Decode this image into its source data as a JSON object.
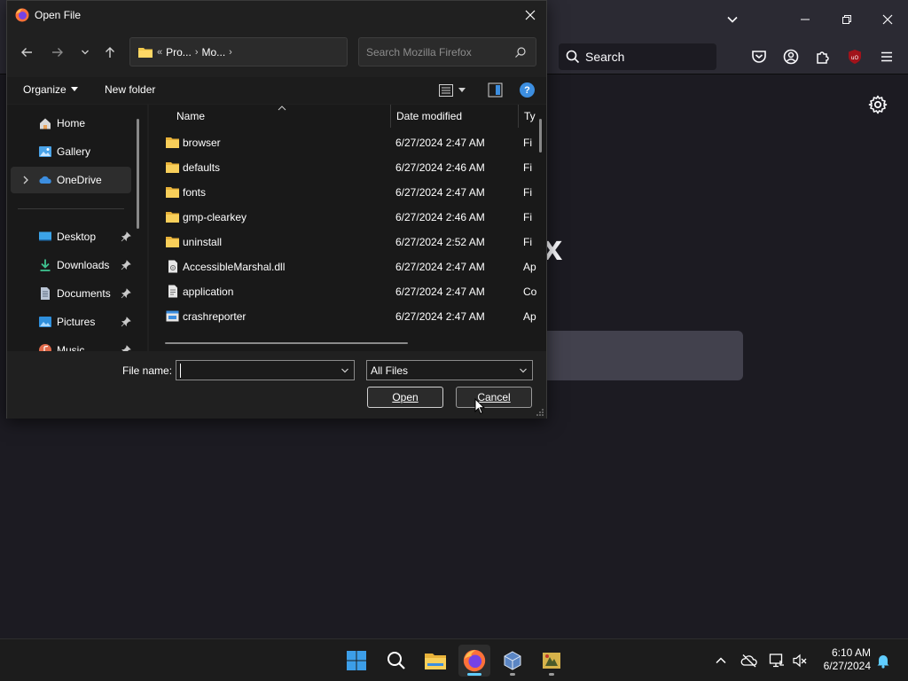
{
  "firefox": {
    "search_label": "Search",
    "logo_fragment": "x"
  },
  "dialog": {
    "title": "Open File",
    "address": {
      "overflow": "«",
      "crumb1": "Pro...",
      "crumb2": "Mo..."
    },
    "search_placeholder": "Search Mozilla Firefox",
    "organize_label": "Organize",
    "new_folder_label": "New folder",
    "nav_items": [
      {
        "label": "Home",
        "icon": "home-icon"
      },
      {
        "label": "Gallery",
        "icon": "gallery-icon"
      },
      {
        "label": "OneDrive",
        "icon": "onedrive-icon",
        "selected": true
      },
      {
        "label": "Desktop",
        "icon": "desktop-icon",
        "pinned": true
      },
      {
        "label": "Downloads",
        "icon": "downloads-icon",
        "pinned": true
      },
      {
        "label": "Documents",
        "icon": "documents-icon",
        "pinned": true
      },
      {
        "label": "Pictures",
        "icon": "pictures-icon",
        "pinned": true
      },
      {
        "label": "Music",
        "icon": "music-icon",
        "pinned": true
      }
    ],
    "columns": {
      "name": "Name",
      "date": "Date modified",
      "type": "Ty"
    },
    "files": [
      {
        "name": "browser",
        "date": "6/27/2024 2:47 AM",
        "type": "Fi",
        "kind": "folder"
      },
      {
        "name": "defaults",
        "date": "6/27/2024 2:46 AM",
        "type": "Fi",
        "kind": "folder"
      },
      {
        "name": "fonts",
        "date": "6/27/2024 2:47 AM",
        "type": "Fi",
        "kind": "folder"
      },
      {
        "name": "gmp-clearkey",
        "date": "6/27/2024 2:46 AM",
        "type": "Fi",
        "kind": "folder"
      },
      {
        "name": "uninstall",
        "date": "6/27/2024 2:52 AM",
        "type": "Fi",
        "kind": "folder"
      },
      {
        "name": "AccessibleMarshal.dll",
        "date": "6/27/2024 2:47 AM",
        "type": "Ap",
        "kind": "dll"
      },
      {
        "name": "application",
        "date": "6/27/2024 2:47 AM",
        "type": "Co",
        "kind": "config"
      },
      {
        "name": "crashreporter",
        "date": "6/27/2024 2:47 AM",
        "type": "Ap",
        "kind": "exe"
      }
    ],
    "file_name_label": "File name:",
    "file_name_value": "",
    "file_type": "All Files",
    "open_label": "Open",
    "cancel_label": "Cancel"
  },
  "taskbar": {
    "time": "6:10 AM",
    "date": "6/27/2024"
  },
  "colors": {
    "accent": "#3c8ee0",
    "folder": "#f2c94c",
    "firefox_bg": "#1c1b22",
    "dialog_bg": "#202020"
  }
}
